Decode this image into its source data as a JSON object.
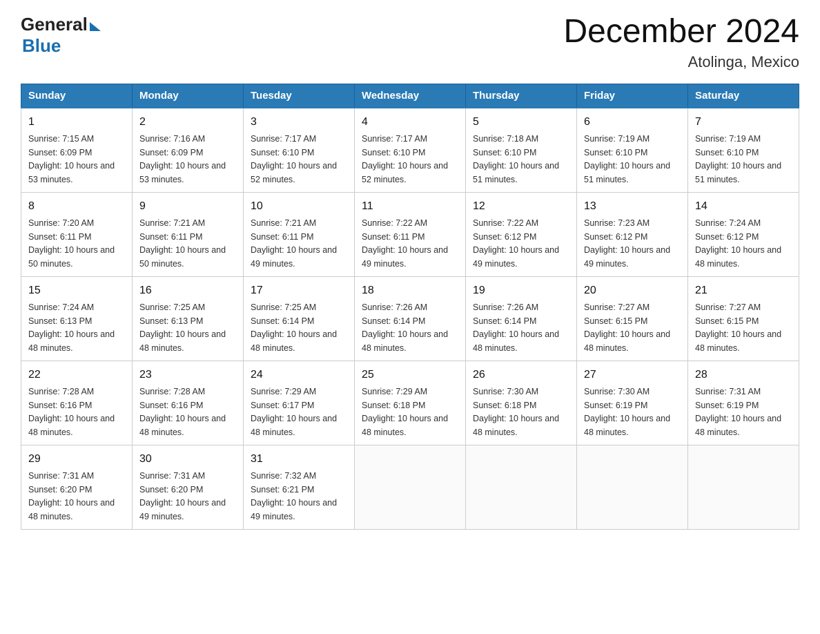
{
  "header": {
    "logo_general": "General",
    "logo_blue": "Blue",
    "month_year": "December 2024",
    "location": "Atolinga, Mexico"
  },
  "calendar": {
    "days_of_week": [
      "Sunday",
      "Monday",
      "Tuesday",
      "Wednesday",
      "Thursday",
      "Friday",
      "Saturday"
    ],
    "weeks": [
      [
        {
          "day": "1",
          "sunrise": "7:15 AM",
          "sunset": "6:09 PM",
          "daylight": "10 hours and 53 minutes."
        },
        {
          "day": "2",
          "sunrise": "7:16 AM",
          "sunset": "6:09 PM",
          "daylight": "10 hours and 53 minutes."
        },
        {
          "day": "3",
          "sunrise": "7:17 AM",
          "sunset": "6:10 PM",
          "daylight": "10 hours and 52 minutes."
        },
        {
          "day": "4",
          "sunrise": "7:17 AM",
          "sunset": "6:10 PM",
          "daylight": "10 hours and 52 minutes."
        },
        {
          "day": "5",
          "sunrise": "7:18 AM",
          "sunset": "6:10 PM",
          "daylight": "10 hours and 51 minutes."
        },
        {
          "day": "6",
          "sunrise": "7:19 AM",
          "sunset": "6:10 PM",
          "daylight": "10 hours and 51 minutes."
        },
        {
          "day": "7",
          "sunrise": "7:19 AM",
          "sunset": "6:10 PM",
          "daylight": "10 hours and 51 minutes."
        }
      ],
      [
        {
          "day": "8",
          "sunrise": "7:20 AM",
          "sunset": "6:11 PM",
          "daylight": "10 hours and 50 minutes."
        },
        {
          "day": "9",
          "sunrise": "7:21 AM",
          "sunset": "6:11 PM",
          "daylight": "10 hours and 50 minutes."
        },
        {
          "day": "10",
          "sunrise": "7:21 AM",
          "sunset": "6:11 PM",
          "daylight": "10 hours and 49 minutes."
        },
        {
          "day": "11",
          "sunrise": "7:22 AM",
          "sunset": "6:11 PM",
          "daylight": "10 hours and 49 minutes."
        },
        {
          "day": "12",
          "sunrise": "7:22 AM",
          "sunset": "6:12 PM",
          "daylight": "10 hours and 49 minutes."
        },
        {
          "day": "13",
          "sunrise": "7:23 AM",
          "sunset": "6:12 PM",
          "daylight": "10 hours and 49 minutes."
        },
        {
          "day": "14",
          "sunrise": "7:24 AM",
          "sunset": "6:12 PM",
          "daylight": "10 hours and 48 minutes."
        }
      ],
      [
        {
          "day": "15",
          "sunrise": "7:24 AM",
          "sunset": "6:13 PM",
          "daylight": "10 hours and 48 minutes."
        },
        {
          "day": "16",
          "sunrise": "7:25 AM",
          "sunset": "6:13 PM",
          "daylight": "10 hours and 48 minutes."
        },
        {
          "day": "17",
          "sunrise": "7:25 AM",
          "sunset": "6:14 PM",
          "daylight": "10 hours and 48 minutes."
        },
        {
          "day": "18",
          "sunrise": "7:26 AM",
          "sunset": "6:14 PM",
          "daylight": "10 hours and 48 minutes."
        },
        {
          "day": "19",
          "sunrise": "7:26 AM",
          "sunset": "6:14 PM",
          "daylight": "10 hours and 48 minutes."
        },
        {
          "day": "20",
          "sunrise": "7:27 AM",
          "sunset": "6:15 PM",
          "daylight": "10 hours and 48 minutes."
        },
        {
          "day": "21",
          "sunrise": "7:27 AM",
          "sunset": "6:15 PM",
          "daylight": "10 hours and 48 minutes."
        }
      ],
      [
        {
          "day": "22",
          "sunrise": "7:28 AM",
          "sunset": "6:16 PM",
          "daylight": "10 hours and 48 minutes."
        },
        {
          "day": "23",
          "sunrise": "7:28 AM",
          "sunset": "6:16 PM",
          "daylight": "10 hours and 48 minutes."
        },
        {
          "day": "24",
          "sunrise": "7:29 AM",
          "sunset": "6:17 PM",
          "daylight": "10 hours and 48 minutes."
        },
        {
          "day": "25",
          "sunrise": "7:29 AM",
          "sunset": "6:18 PM",
          "daylight": "10 hours and 48 minutes."
        },
        {
          "day": "26",
          "sunrise": "7:30 AM",
          "sunset": "6:18 PM",
          "daylight": "10 hours and 48 minutes."
        },
        {
          "day": "27",
          "sunrise": "7:30 AM",
          "sunset": "6:19 PM",
          "daylight": "10 hours and 48 minutes."
        },
        {
          "day": "28",
          "sunrise": "7:31 AM",
          "sunset": "6:19 PM",
          "daylight": "10 hours and 48 minutes."
        }
      ],
      [
        {
          "day": "29",
          "sunrise": "7:31 AM",
          "sunset": "6:20 PM",
          "daylight": "10 hours and 48 minutes."
        },
        {
          "day": "30",
          "sunrise": "7:31 AM",
          "sunset": "6:20 PM",
          "daylight": "10 hours and 49 minutes."
        },
        {
          "day": "31",
          "sunrise": "7:32 AM",
          "sunset": "6:21 PM",
          "daylight": "10 hours and 49 minutes."
        },
        null,
        null,
        null,
        null
      ]
    ]
  }
}
